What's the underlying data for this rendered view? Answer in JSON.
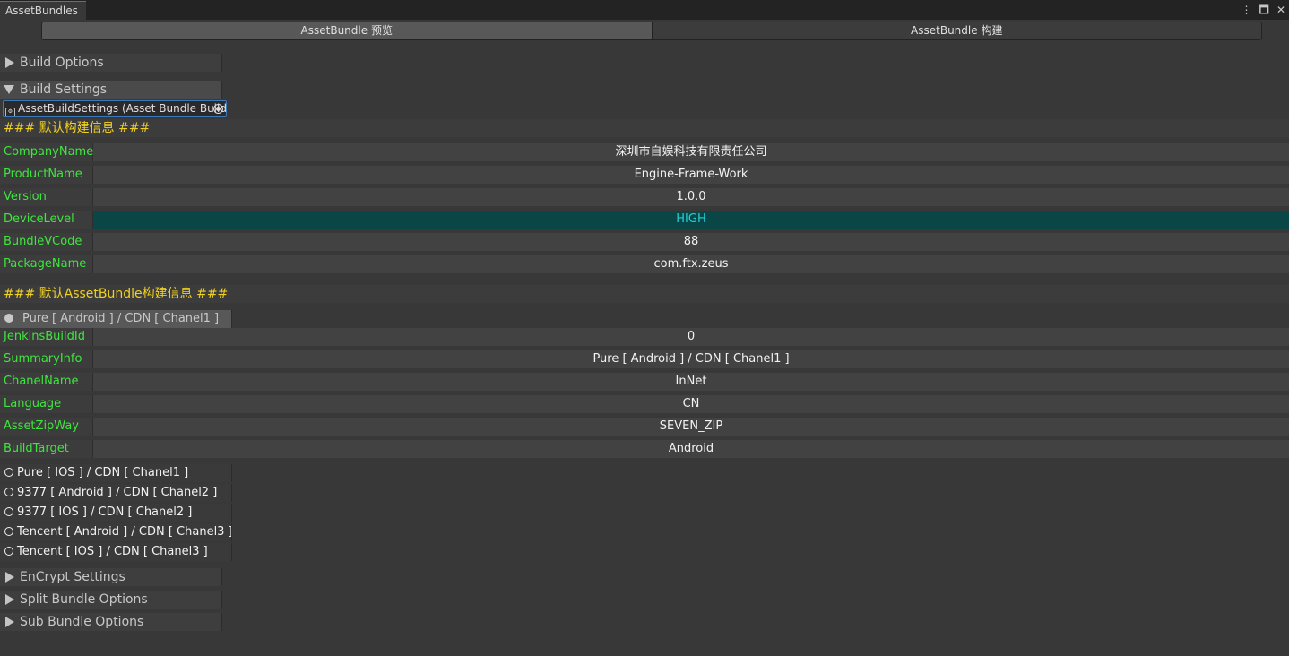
{
  "window": {
    "tab_title": "AssetBundles"
  },
  "toolbar": {
    "tabs": [
      "AssetBundle 预览",
      "AssetBundle 构建"
    ]
  },
  "foldouts": {
    "build_options": "Build  Options",
    "build_settings": "Build Settings",
    "encrypt": "EnCrypt Settings",
    "split": "Split Bundle Options",
    "sub": "Sub Bundle Options"
  },
  "object_field": {
    "value": "AssetBuildSettings (Asset Bundle Build"
  },
  "default_build": {
    "heading": "### 默认构建信息 ###",
    "rows": [
      {
        "label": "CompanyName",
        "value": "深圳市自娱科技有限责任公司"
      },
      {
        "label": "ProductName",
        "value": "Engine-Frame-Work"
      },
      {
        "label": "Version",
        "value": "1.0.0"
      },
      {
        "label": "DeviceLevel",
        "value": "HIGH"
      },
      {
        "label": "BundleVCode",
        "value": "88"
      },
      {
        "label": "PackageName",
        "value": "com.ftx.zeus"
      }
    ]
  },
  "assetbundle_build": {
    "heading": "### 默认AssetBundle构建信息 ###",
    "selected_channel": "Pure [ Android ] /  CDN [ Chanel1 ]",
    "rows": [
      {
        "label": "JenkinsBuildId",
        "value": "0"
      },
      {
        "label": "SummaryInfo",
        "value": "Pure [ Android ] /  CDN [ Chanel1 ]"
      },
      {
        "label": "ChanelName",
        "value": "InNet"
      },
      {
        "label": "Language",
        "value": "CN"
      },
      {
        "label": "AssetZipWay",
        "value": "SEVEN_ZIP"
      },
      {
        "label": "BuildTarget",
        "value": "Android"
      }
    ],
    "other_channels": [
      "Pure [ IOS ] /  CDN [ Chanel1 ]",
      "9377 [ Android ] /  CDN [ Chanel2 ]",
      "9377 [ IOS ] /  CDN [ Chanel2 ]",
      "Tencent [ Android ] /  CDN [ Chanel3 ]",
      "Tencent [ IOS ] /  CDN [ Chanel3 ]"
    ]
  },
  "colors": {
    "label_green": "#3ee63e",
    "heading_yellow": "#f0d020",
    "highlight_bg": "#0a4646",
    "highlight_text": "#22d0d8"
  }
}
